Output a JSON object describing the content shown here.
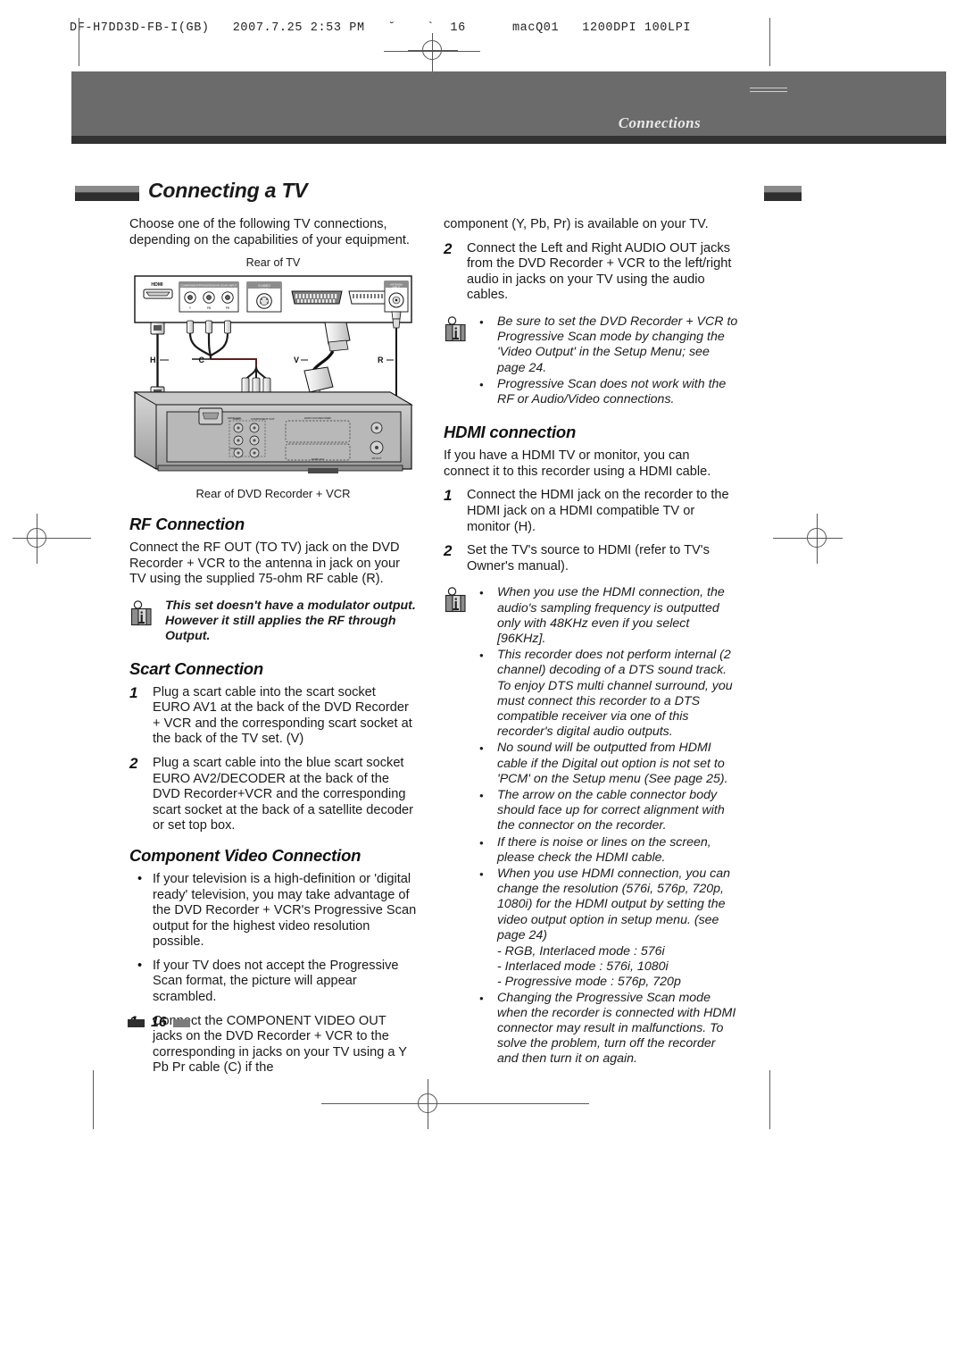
{
  "print_slug": "DF-H7DD3D-FB-I(GB)   2007.7.25 2:53 PM   ˘    `  16      macQ01   1200DPI 100LPI",
  "banner": {
    "chapter_label": "Connections"
  },
  "heading": {
    "title": "Connecting a TV"
  },
  "left_column": {
    "intro": "Choose one of the following TV connections, depending on the capabilities of your equipment.",
    "figure": {
      "caption_top": "Rear of TV",
      "caption_bottom": "Rear of DVD Recorder + VCR",
      "tv_port_labels": [
        "HDMI",
        "COMPONENT/PROGRESSIVE SCAN INPUT",
        "S-VIDEO INPUT",
        "SCART",
        "SCART",
        "ANTENNA INPUT"
      ],
      "cable_markers": [
        "H",
        "C",
        "V",
        "R"
      ],
      "recorder_labels": [
        "EURO AV2 DECODER",
        "EURO AV1",
        "RF OUT",
        "COMPONENT OUT",
        "AUDIO",
        "VIDEO"
      ]
    },
    "rf_connection": {
      "title": "RF Connection",
      "body": "Connect the RF OUT (TO TV) jack on the DVD Recorder + VCR to the antenna in jack on your TV using the supplied 75-ohm RF cable (R).",
      "note": "This set doesn't have a modulator output. However it still applies the RF through Output."
    },
    "scart_connection": {
      "title": "Scart Connection",
      "steps": [
        {
          "num": "1",
          "text": "Plug a scart cable into the scart socket EURO AV1 at the back of the DVD Recorder + VCR and the corresponding scart socket at the back of the TV set. (V)"
        },
        {
          "num": "2",
          "text": "Plug a scart cable into the blue scart socket EURO AV2/DECODER at the back of the DVD Recorder+VCR and the corresponding scart socket at the back of a satellite decoder or set top box."
        }
      ]
    },
    "component_video_connection": {
      "title": "Component Video Connection",
      "bullets": [
        "If your television is a high-definition or 'digital ready' television, you may take advantage of the DVD Recorder + VCR's Progressive Scan output for the highest video resolution possible.",
        "If your TV does not accept the Progressive Scan format, the picture will appear scrambled."
      ],
      "steps": [
        {
          "num": "1",
          "text": "Connect the COMPONENT VIDEO OUT jacks on the DVD Recorder + VCR to the corresponding in jacks on your TV using a Y Pb Pr cable (C) if the"
        }
      ]
    }
  },
  "right_column": {
    "continued_text": "component (Y, Pb, Pr) is available on your TV.",
    "component_steps": [
      {
        "num": "2",
        "text": "Connect the Left and Right AUDIO OUT jacks from the DVD Recorder + VCR to the left/right audio in jacks on your TV using the audio cables."
      }
    ],
    "component_note_bullets": [
      "Be sure to set the DVD Recorder + VCR to Progressive Scan mode by changing the 'Video Output' in the Setup Menu; see page 24.",
      "Progressive Scan does not work with the RF or Audio/Video connections."
    ],
    "hdmi_connection": {
      "title": "HDMI connection",
      "intro": "If you have a HDMI TV or monitor, you can connect it to this recorder using a HDMI cable.",
      "steps": [
        {
          "num": "1",
          "text": "Connect the HDMI jack on the recorder to the HDMI jack on a HDMI compatible TV or monitor (H)."
        },
        {
          "num": "2",
          "text": "Set the TV's source to HDMI (refer to TV's Owner's manual)."
        }
      ],
      "note_bullets": [
        "When you use the HDMI connection, the audio's sampling frequency is outputted only with 48KHz even if you select [96KHz].",
        "This recorder does not perform internal (2 channel) decoding of a DTS sound track. To enjoy DTS multi channel surround, you must connect this recorder to a DTS compatible receiver via one of this recorder's digital audio outputs.",
        "No sound will be outputted from HDMI cable if the Digital out option is not set to 'PCM' on the Setup menu (See page 25).",
        "The arrow on the cable connector body should face up for correct alignment with the connector on the recorder.",
        "If there is noise or lines on the screen, please check the HDMI cable.",
        "When you use HDMI connection, you can change the resolution (576i, 576p, 720p, 1080i) for the HDMI output by setting the video output option in setup menu. (see page 24)"
      ],
      "resolution_modes": [
        "- RGB, Interlaced mode : 576i",
        "- Interlaced mode : 576i, 1080i",
        "- Progressive mode : 576p, 720p"
      ],
      "note_bullets_tail": [
        "Changing the Progressive Scan mode when the recorder is connected with HDMI connector may result in malfunctions. To solve the problem, turn off the recorder and then turn it on again."
      ]
    }
  },
  "footer": {
    "page_number": "16"
  },
  "colors": {
    "banner": "#6b6b6b",
    "banner_rule": "#333333",
    "text": "#1a1a1a",
    "mark": "#555555"
  }
}
